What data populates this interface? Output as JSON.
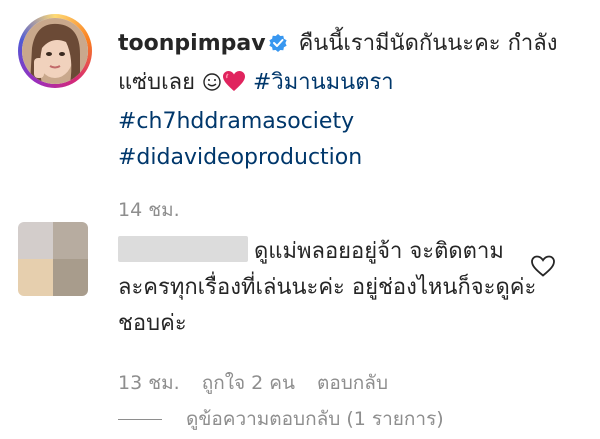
{
  "post": {
    "username": "toonpimpav",
    "caption_text": "คืนนี้เรามีนัดกันนะคะ กำลังแซ่บเลย",
    "hashtags": [
      "#วิมานมนตรา",
      "#ch7hddramasociety",
      "#didavideoproduction"
    ],
    "timestamp": "14 ชม."
  },
  "comment": {
    "text": "ดูแม่พลอยอยู่จ้า จะติดตามละครทุกเรื่องที่เล่นนะค่ะ อยู่ช่องไหนก็จะดูค่ะ ชอบค่ะ",
    "timestamp": "13 ชม.",
    "likes_label": "ถูกใจ 2 คน",
    "reply_label": "ตอบกลับ",
    "view_replies_label": "ดูข้อความตอบกลับ (1 รายการ)"
  },
  "colors": {
    "link": "#00376b",
    "verified": "#3897f0",
    "muted": "#8e8e8e",
    "heart_emoji": "#e0245e"
  },
  "icons": [
    "verified-badge-icon",
    "smile-emoji-icon",
    "red-heart-emoji-icon",
    "heart-outline-icon"
  ]
}
